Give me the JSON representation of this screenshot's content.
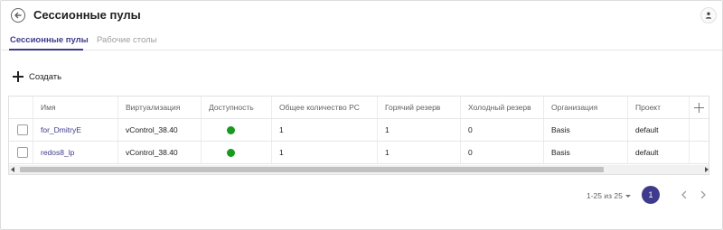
{
  "header": {
    "title": "Сессионные пулы"
  },
  "tabs": [
    {
      "label": "Сессионные пулы",
      "active": true
    },
    {
      "label": "Рабочие столы",
      "active": false
    }
  ],
  "toolbar": {
    "create_label": "Создать"
  },
  "table": {
    "columns": [
      "Имя",
      "Виртуализация",
      "Доступность",
      "Общее количество PC",
      "Горячий резерв",
      "Холодный резерв",
      "Организация",
      "Проект"
    ],
    "rows": [
      {
        "name": "for_DmitryE",
        "virtualization": "vControl_38.40",
        "availability": "online",
        "total_pc": "1",
        "hot_reserve": "1",
        "cold_reserve": "0",
        "organization": "Basis",
        "project": "default"
      },
      {
        "name": "redos8_lp",
        "virtualization": "vControl_38.40",
        "availability": "online",
        "total_pc": "1",
        "hot_reserve": "1",
        "cold_reserve": "0",
        "organization": "Basis",
        "project": "default"
      }
    ]
  },
  "pagination": {
    "range_label": "1-25 из 25",
    "current_page": "1"
  },
  "colors": {
    "accent": "#3f3a8c",
    "status_online": "#189a1e"
  },
  "icons": {
    "back": "back-arrow-icon",
    "user": "user-icon",
    "add": "plus-icon",
    "add_column": "plus-icon",
    "prev": "chevron-left-icon",
    "next": "chevron-right-icon"
  }
}
